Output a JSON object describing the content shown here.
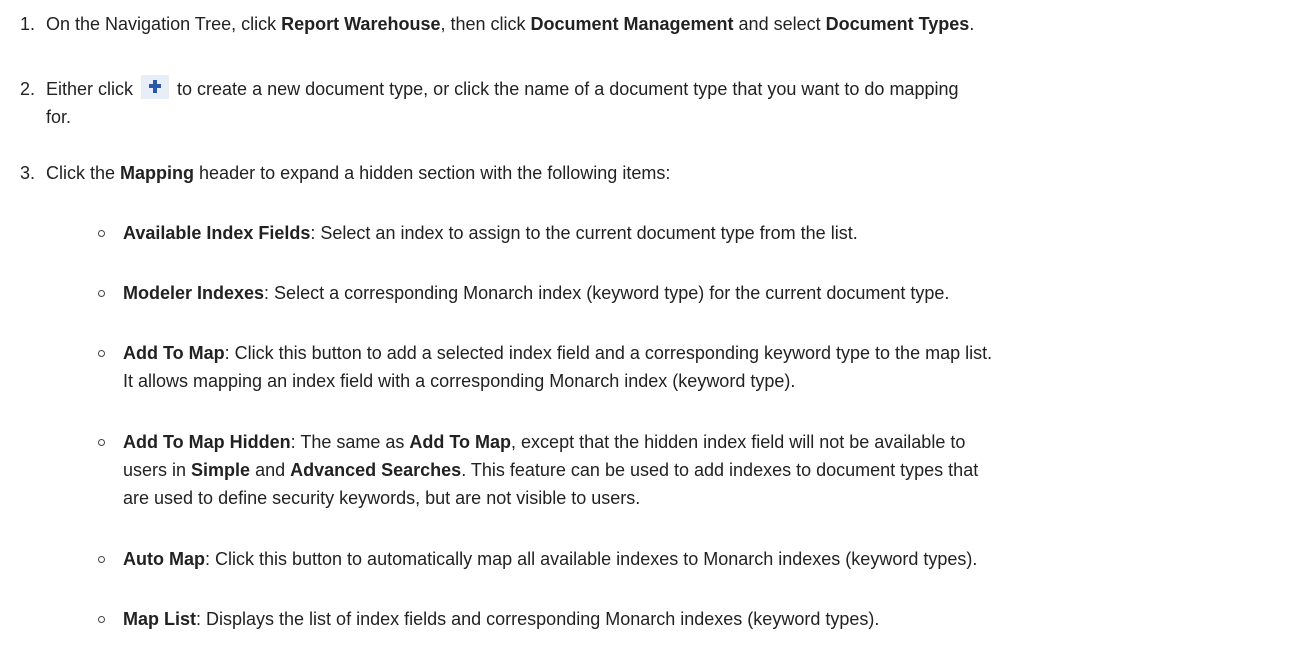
{
  "steps": [
    {
      "num": "1.",
      "t1": "On the Navigation Tree, click ",
      "b1": "Report Warehouse",
      "t2": ", then click ",
      "b2": "Document Management",
      "t3": " and select ",
      "b3": "Document Types",
      "t4": "."
    },
    {
      "num": "2.",
      "t1": "Either click ",
      "t2": " to create a new document type, or click the name of a document type that you want to do mapping",
      "t3": "for."
    },
    {
      "num": "3.",
      "t1": "Click the ",
      "b1": "Mapping",
      "t2": " header to expand a hidden section with the following items:"
    }
  ],
  "items": [
    {
      "b1": "Available Index Fields",
      "t1": ": Select an index to assign to the current document type from the list."
    },
    {
      "b1": "Modeler Indexes",
      "t1": ": Select a corresponding Monarch index (keyword type) for the current document type."
    },
    {
      "b1": "Add To Map",
      "t1": ": Click this button to add a selected index field and a corresponding keyword type to the map list.",
      "t2": "It allows mapping an index field with a corresponding Monarch index (keyword type)."
    },
    {
      "b1": "Add To Map Hidden",
      "t1": ": The same as ",
      "b2": "Add To Map",
      "t2": ", except that the hidden index field will not be available to",
      "t3": "users in ",
      "b3": "Simple",
      "t4": " and ",
      "b4": "Advanced Searches",
      "t5": ". This feature can be used to add indexes to document types that",
      "t6": "are used to define security keywords, but are not visible to users."
    },
    {
      "b1": "Auto Map",
      "t1": ": Click this button to automatically map all available indexes to Monarch indexes (keyword types)."
    },
    {
      "b1": "Map List",
      "t1": ": Displays the list of index fields and corresponding Monarch indexes (keyword types)."
    }
  ],
  "icons": {
    "add": "plus-icon",
    "bullet": "hollow-circle-bullet"
  },
  "colors": {
    "text": "#222222",
    "icon_plus": "#2a57a8",
    "icon_bg": "#e7eef7"
  }
}
